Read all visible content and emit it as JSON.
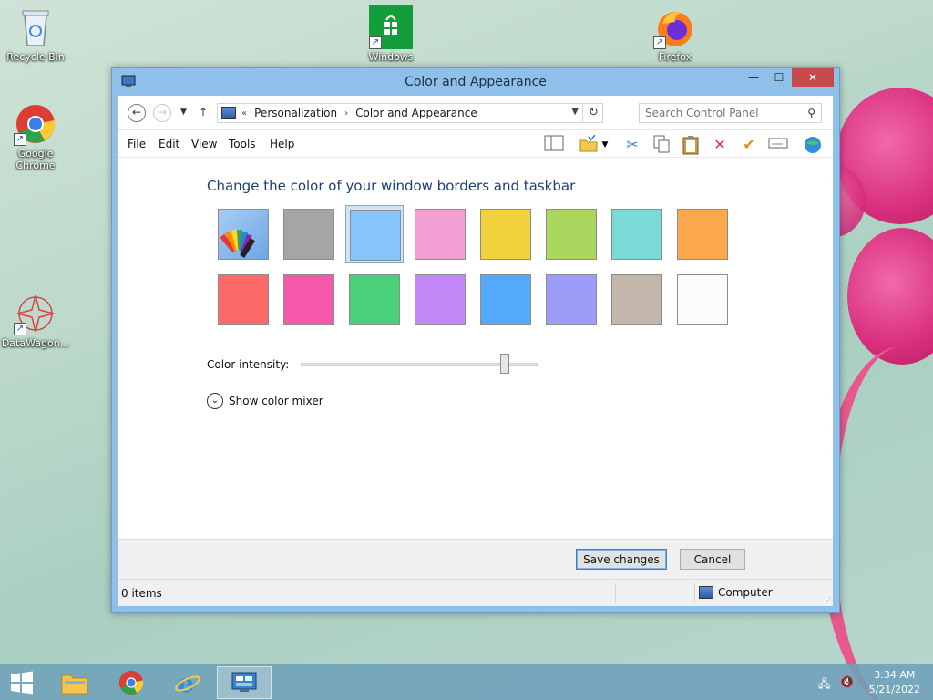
{
  "desktop": {
    "icons": [
      {
        "name": "recycle-bin",
        "label": "Recycle Bin"
      },
      {
        "name": "windows-store",
        "label": "Windows"
      },
      {
        "name": "firefox",
        "label": "Firefox"
      },
      {
        "name": "google-chrome",
        "label": "Google Chrome"
      },
      {
        "name": "datawagon",
        "label": "DataWagon..."
      }
    ]
  },
  "window": {
    "title": "Color and Appearance",
    "controls": {
      "minimize": "—",
      "maximize": "☐",
      "close": "✕"
    }
  },
  "address": {
    "prefix": "«",
    "crumbs": [
      "Personalization",
      "Color and Appearance"
    ],
    "search_placeholder": "Search Control Panel"
  },
  "menu": [
    "File",
    "Edit",
    "View",
    "Tools",
    "Help"
  ],
  "content": {
    "heading": "Change the color of your window borders and taskbar",
    "swatches_row1": [
      "multicolor",
      "#a5a5a5",
      "#86c4fb",
      "#f49ed6",
      "#f2d23c",
      "#aad85e",
      "#79dad6",
      "#fca74d"
    ],
    "swatches_row2": [
      "#fd6a6a",
      "#f659a9",
      "#4ad07b",
      "#c387f7",
      "#54aaf9",
      "#9d9cf9",
      "#c2b5aa",
      "#fbfbfb"
    ],
    "selected_index": 2,
    "intensity_label": "Color intensity:",
    "intensity_value_fraction": 0.86,
    "mixer_label": "Show color mixer"
  },
  "buttons": {
    "save": "Save changes",
    "cancel": "Cancel"
  },
  "status": {
    "items": "0 items",
    "location": "Computer"
  },
  "taskbar": {
    "time": "3:34 AM",
    "date": "5/21/2022"
  },
  "colors": {
    "window_frame": "#8fc0ea",
    "close": "#c74a4a",
    "heading": "#1e3f75"
  }
}
